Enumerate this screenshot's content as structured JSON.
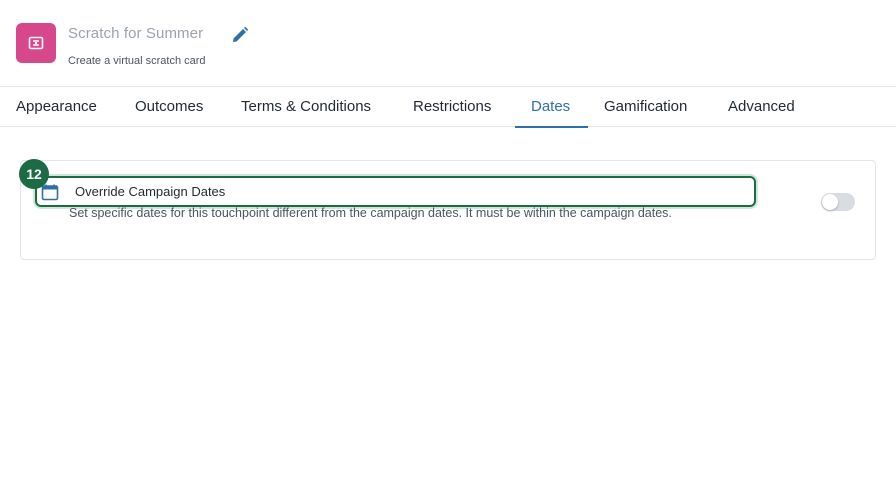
{
  "header": {
    "title": "Scratch for Summer",
    "subtitle": "Create a virtual scratch card",
    "app_icon": "ticket-icon",
    "edit_icon": "pencil-icon",
    "brand_color": "#d6478c"
  },
  "tabs": [
    {
      "label": "Appearance",
      "active": false
    },
    {
      "label": "Outcomes",
      "active": false
    },
    {
      "label": "Terms & Conditions",
      "active": false
    },
    {
      "label": "Restrictions",
      "active": false
    },
    {
      "label": "Dates",
      "active": true
    },
    {
      "label": "Gamification",
      "active": false
    },
    {
      "label": "Advanced",
      "active": false
    }
  ],
  "accent_color": "#2f6fa7",
  "override_dates": {
    "badge": "12",
    "icon": "calendar-icon",
    "title": "Override Campaign Dates",
    "description": "Set specific dates for this touchpoint different from the campaign dates. It must be within the campaign dates.",
    "toggle_on": false,
    "highlight_color": "#1d6b45"
  }
}
